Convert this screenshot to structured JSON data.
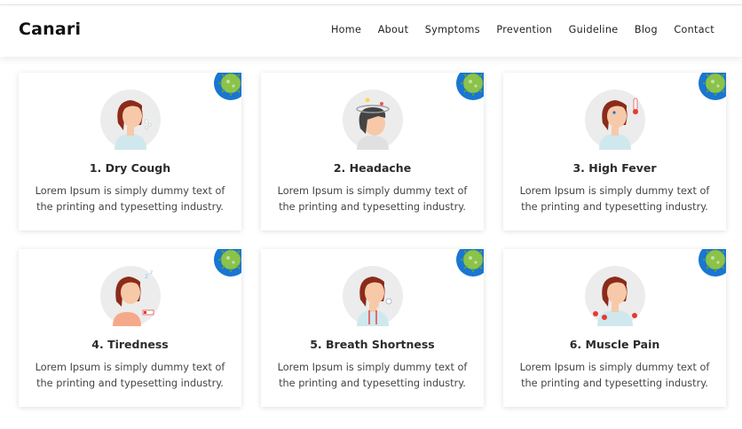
{
  "brand": "Canari",
  "nav": [
    "Home",
    "About",
    "Symptoms",
    "Prevention",
    "Guideline",
    "Blog",
    "Contact"
  ],
  "symptoms": [
    {
      "title": "1. Dry Cough",
      "desc": "Lorem Ipsum is simply dummy text of the printing and typesetting industry.",
      "icon": "dry-cough-icon"
    },
    {
      "title": "2. Headache",
      "desc": "Lorem Ipsum is simply dummy text of the printing and typesetting industry.",
      "icon": "headache-icon"
    },
    {
      "title": "3. High Fever",
      "desc": "Lorem Ipsum is simply dummy text of the printing and typesetting industry.",
      "icon": "high-fever-icon"
    },
    {
      "title": "4. Tiredness",
      "desc": "Lorem Ipsum is simply dummy text of the printing and typesetting industry.",
      "icon": "tiredness-icon"
    },
    {
      "title": "5. Breath Shortness",
      "desc": "Lorem Ipsum is simply dummy text of the printing and typesetting industry.",
      "icon": "breath-shortness-icon"
    },
    {
      "title": "6. Muscle Pain",
      "desc": "Lorem Ipsum is simply dummy text of the printing and typesetting industry.",
      "icon": "muscle-pain-icon"
    }
  ],
  "colors": {
    "badge_blue": "#1976d2",
    "virus_green": "#8bc34a",
    "hair": "#8b2b1a",
    "skin": "#f7c9a8",
    "shirt": "#cfe8ee",
    "avatar_bg": "#ececec"
  }
}
